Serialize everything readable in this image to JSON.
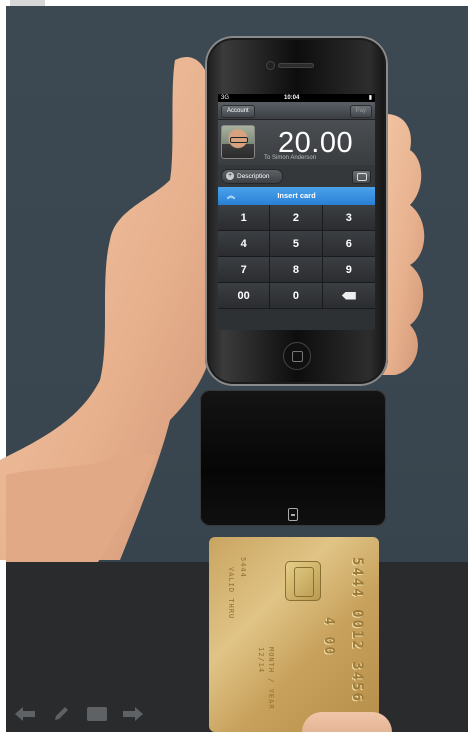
{
  "window": {
    "title": ""
  },
  "phone_app": {
    "status": {
      "signal": "3G",
      "time": "10:04",
      "battery": "▮"
    },
    "navbar": {
      "left_button": "Account",
      "right_button": "Pay"
    },
    "payment": {
      "amount": "20.00",
      "recipient": "To Simon Anderson"
    },
    "description_button": "Description",
    "insert_card_label": "Insert card",
    "keypad": [
      "1",
      "2",
      "3",
      "4",
      "5",
      "6",
      "7",
      "8",
      "9",
      "00",
      "0"
    ]
  },
  "card": {
    "number_a": "5444 0012 3456",
    "number_b": "4 00",
    "line1": "5444",
    "line2": "VALID THRU",
    "line3": "MONTH / YEAR",
    "line4": "12/14"
  },
  "toolbar": {
    "icons": [
      "arrow-left-icon",
      "pen-icon",
      "keyboard-icon",
      "arrow-right-icon"
    ]
  },
  "colors": {
    "accent": "#2a7fd4",
    "card_gold": "#d8b870",
    "background": "#3c4852"
  }
}
